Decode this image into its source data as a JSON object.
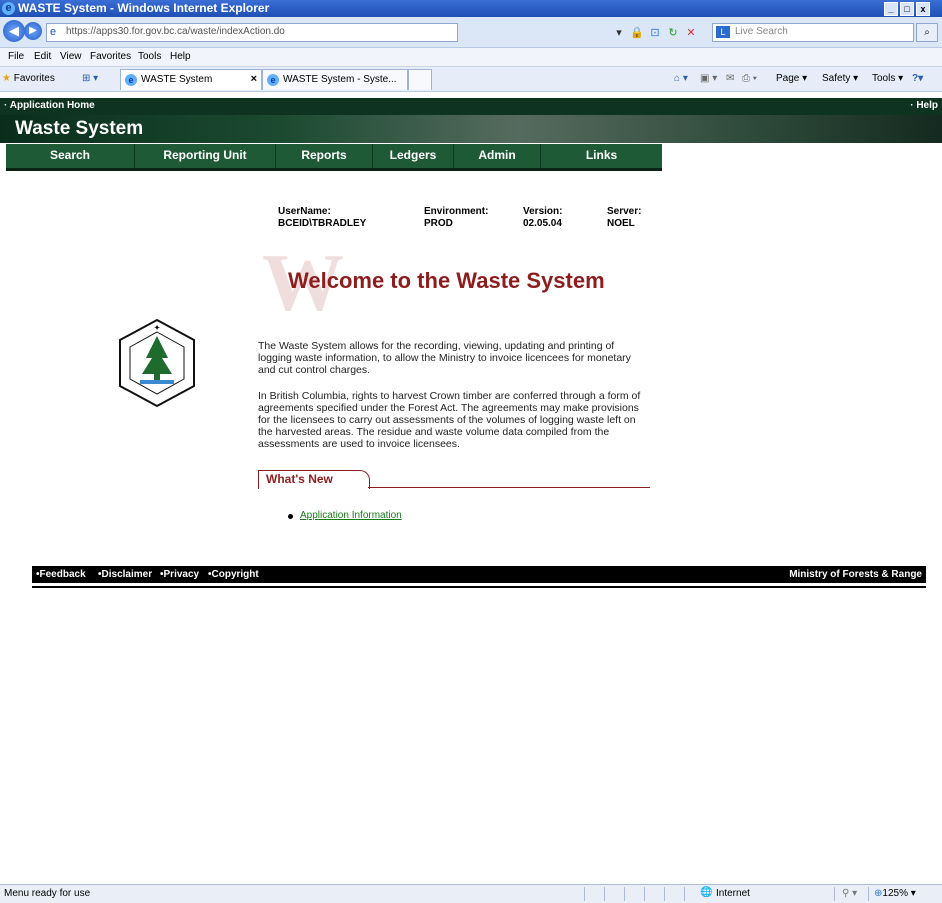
{
  "window": {
    "title": "WASTE System - Windows Internet Explorer",
    "controls": [
      "_",
      "□",
      "x"
    ]
  },
  "addressbar": {
    "url": "https://apps30.for.gov.bc.ca/waste/indexAction.do",
    "search_placeholder": "Live Search"
  },
  "menu": [
    "File",
    "Edit",
    "View",
    "Favorites",
    "Tools",
    "Help"
  ],
  "favorites": {
    "label": "Favorites",
    "tabs": [
      "WASTE System",
      "WASTE System - Syste..."
    ],
    "commands": [
      "Page",
      "Safety",
      "Tools"
    ]
  },
  "header": {
    "app_home": "· Application Home",
    "help": "· Help",
    "banner_title": "Waste System"
  },
  "nav": [
    "Search",
    "Reporting Unit",
    "Reports",
    "Ledgers",
    "Admin",
    "Links"
  ],
  "info": {
    "username_label": "UserName:",
    "username_value": "BCEID\\TBRADLEY",
    "env_label": "Environment:",
    "env_value": "PROD",
    "version_label": "Version:",
    "version_value": "02.05.04",
    "server_label": "Server:",
    "server_value": "NOEL"
  },
  "welcome": {
    "big_letter": "W",
    "title": "Welcome to the Waste System",
    "para1": "The Waste System allows for the recording, viewing, updating and printing of logging waste information, to allow the Ministry to invoice licencees for monetary and cut control charges.",
    "para2": "In British Columbia, rights to harvest Crown timber are conferred through a form of agreements specified under the Forest Act. The agreements may make provisions for the licensees to carry out assessments of the volumes of logging waste left on the harvested areas. The residue and waste volume data compiled from the assessments are used to invoice licensees."
  },
  "whats_new": {
    "title": "What's New",
    "items": [
      "Application Information"
    ]
  },
  "logo": {
    "top_text": "FOREST SERVICE",
    "bottom_text": "BRITISH COLUMBIA"
  },
  "footer": {
    "links": [
      "•Feedback",
      "•Disclaimer",
      "•Privacy",
      "•Copyright"
    ],
    "ministry": "Ministry of Forests & Range"
  },
  "statusbar": {
    "status": "Menu ready for use",
    "zone": "Internet",
    "zoom": "125%"
  }
}
